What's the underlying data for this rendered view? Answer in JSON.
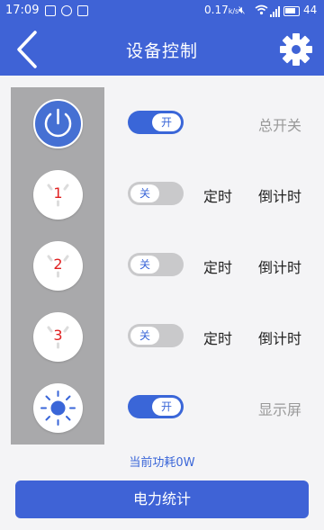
{
  "status_bar": {
    "time": "17:09",
    "network_speed": "0.17",
    "battery_level": "44"
  },
  "header": {
    "title": "设备控制"
  },
  "master": {
    "toggle_label": "开",
    "toggle_on": true,
    "label": "总开关"
  },
  "sockets": [
    {
      "number": "1",
      "toggle_label": "关",
      "toggle_on": false,
      "timer": "定时",
      "countdown": "倒计时"
    },
    {
      "number": "2",
      "toggle_label": "关",
      "toggle_on": false,
      "timer": "定时",
      "countdown": "倒计时"
    },
    {
      "number": "3",
      "toggle_label": "关",
      "toggle_on": false,
      "timer": "定时",
      "countdown": "倒计时"
    }
  ],
  "display": {
    "toggle_label": "开",
    "toggle_on": true,
    "label": "显示屏"
  },
  "power_info": "当前功耗0W",
  "stats_button": "电力统计",
  "colors": {
    "primary": "#3f63d6",
    "toggle_on": "#3a66d8",
    "toggle_off": "#c9c9cb",
    "panel": "#a9a9ab",
    "socket_number": "#e02020"
  }
}
